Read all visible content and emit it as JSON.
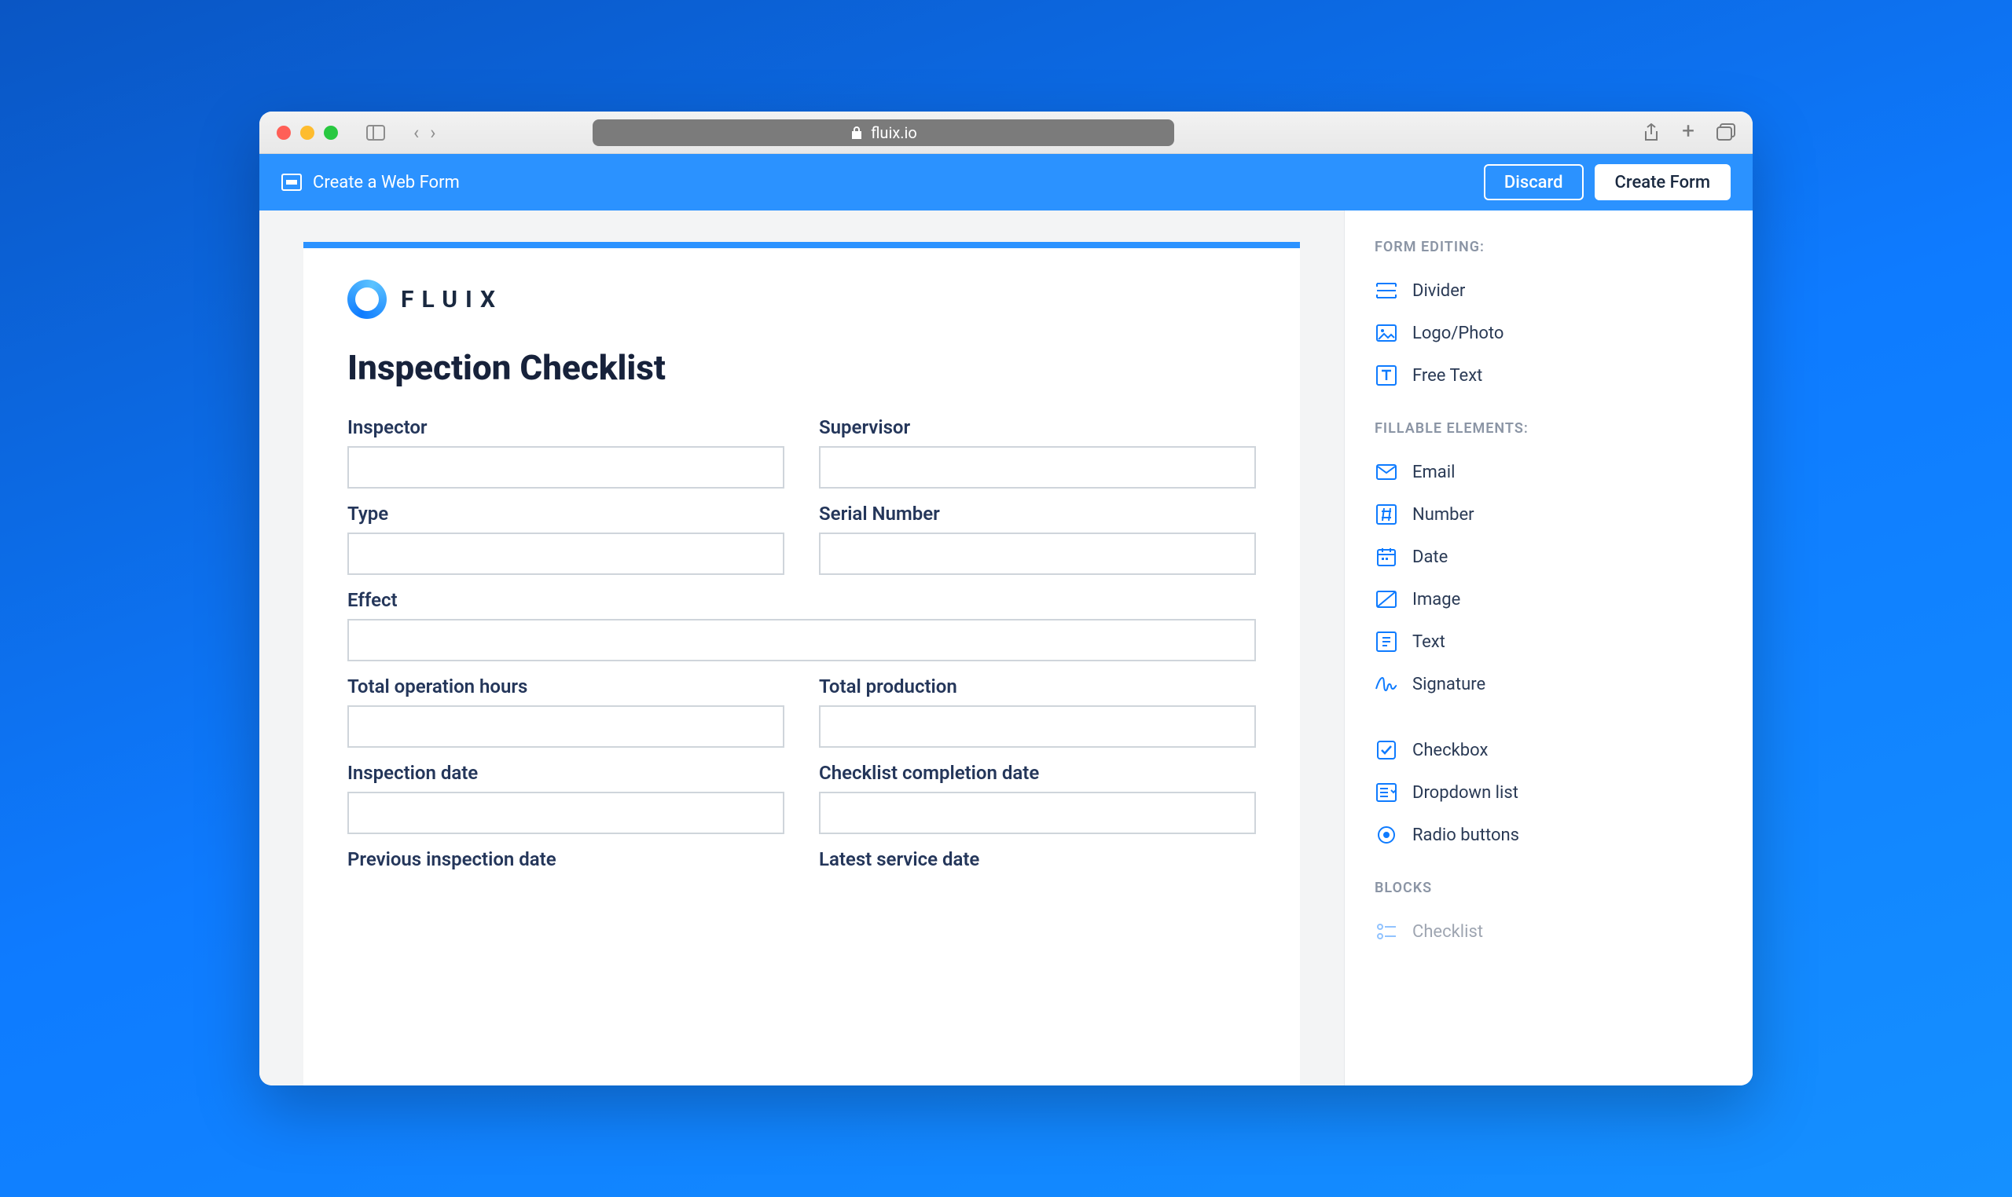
{
  "browser": {
    "url_label": "fluix.io"
  },
  "header": {
    "title": "Create a Web Form",
    "discard_label": "Discard",
    "create_label": "Create Form"
  },
  "form": {
    "brand_name": "FLUIX",
    "title": "Inspection Checklist",
    "fields": {
      "inspector": "Inspector",
      "supervisor": "Supervisor",
      "type": "Type",
      "serial_number": "Serial Number",
      "effect": "Effect",
      "total_operation_hours": "Total operation hours",
      "total_production": "Total production",
      "inspection_date": "Inspection date",
      "checklist_completion_date": "Checklist completion date",
      "previous_inspection_date": "Previous inspection date",
      "latest_service_date": "Latest service date"
    }
  },
  "panel": {
    "section_form_editing": "FORM EDITING:",
    "section_fillable": "FILLABLE ELEMENTS:",
    "section_blocks": "BLOCKS",
    "items": {
      "divider": "Divider",
      "logo_photo": "Logo/Photo",
      "free_text": "Free Text",
      "email": "Email",
      "number": "Number",
      "date": "Date",
      "image": "Image",
      "text": "Text",
      "signature": "Signature",
      "checkbox": "Checkbox",
      "dropdown": "Dropdown list",
      "radio": "Radio buttons",
      "checklist": "Checklist"
    }
  }
}
